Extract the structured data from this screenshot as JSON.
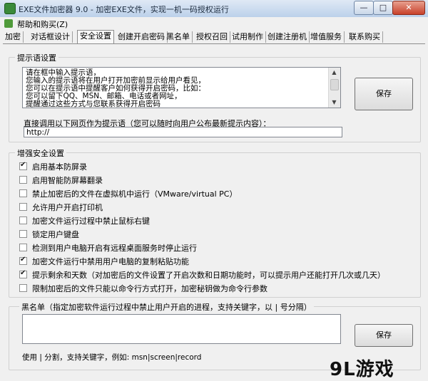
{
  "window": {
    "title": "EXE文件加密器 9.0 - 加密EXE文件，实现一机一码授权运行",
    "min_glyph": "—",
    "max_glyph": "□",
    "close_glyph": "✕"
  },
  "menu": {
    "help_label": "帮助和购买(Z)"
  },
  "tabs": [
    "加密",
    "对话框设计",
    "安全设置",
    "创建开启密码",
    "黑名单",
    "授权召回",
    "试用制作",
    "创建注册机",
    "增值服务",
    "联系购买"
  ],
  "active_tab": "安全设置",
  "prompt_group": {
    "title": "提示语设置",
    "lines": [
      "请在框中输入提示语，",
      "您输入的提示语将在用户打开加密前显示给用户看见，",
      "您可以在提示语中提醒客户如何获得开启密码，比如：",
      "您可以留下QQ、MSN、邮箱、电话或者网址，",
      "提醒通过这些方式与您联系获得开启密码"
    ],
    "save_label": "保存",
    "url_label": "直接调用以下网页作为提示语（您可以随时向用户公布最新提示内容）：",
    "url_value": "http://"
  },
  "security_group": {
    "title": "增强安全设置",
    "options": [
      {
        "label": "启用基本防屏录",
        "checked": true
      },
      {
        "label": "启用智能防屏幕翻录",
        "checked": false
      },
      {
        "label": "禁止加密后的文件在虚拟机中运行（VMware/virtual PC）",
        "checked": false
      },
      {
        "label": "允许用户开启打印机",
        "checked": false
      },
      {
        "label": "加密文件运行过程中禁止鼠标右键",
        "checked": false
      },
      {
        "label": "锁定用户键盘",
        "checked": false
      },
      {
        "label": "检测到用户电脑开启有远程桌面服务时停止运行",
        "checked": false
      },
      {
        "label": "加密文件运行中禁用用户电脑的复制粘贴功能",
        "checked": true
      },
      {
        "label": "提示剩余和天数（对加密后的文件设置了开启次数和日期功能时，可以提示用户还能打开几次或几天）",
        "checked": true
      },
      {
        "label": "限制加密后的文件只能以命令行方式打开，加密秘钥做为命令行参数",
        "checked": false
      }
    ]
  },
  "blacklist_group": {
    "title": "黑名单（指定加密软件运行过程中禁止用户开启的进程，支持关键字，以 | 号分隔）",
    "value": "",
    "save_label": "保存",
    "hint": "使用 | 分割，支持关键字，例如:  msn|screen|record"
  },
  "watermark": {
    "text": "9L游戏"
  }
}
